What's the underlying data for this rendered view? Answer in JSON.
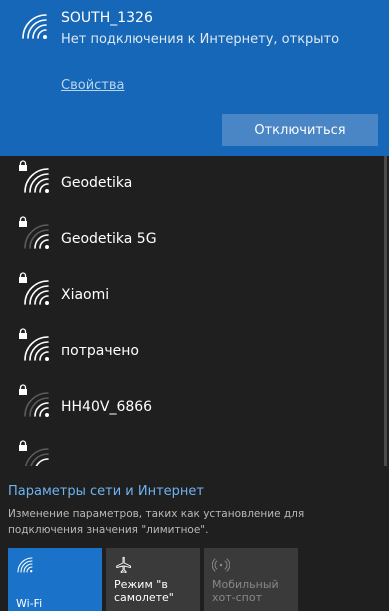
{
  "connected": {
    "name": "SOUTH_1326",
    "status": "Нет подключения к Интернету, открыто",
    "properties_link": "Свойства",
    "disconnect_label": "Отключиться"
  },
  "networks": [
    {
      "name": "Geodetika",
      "secured": true,
      "icon": "wifi-icon"
    },
    {
      "name": "Geodetika 5G",
      "secured": true,
      "icon": "wifi-icon"
    },
    {
      "name": "Xiaomi",
      "secured": true,
      "icon": "wifi-icon"
    },
    {
      "name": "потрачено",
      "secured": true,
      "icon": "wifi-icon"
    },
    {
      "name": "HH40V_6866",
      "secured": true,
      "icon": "wifi-icon"
    }
  ],
  "settings": {
    "link": "Параметры сети и Интернет",
    "description": "Изменение параметров, таких как установление для подключения значения \"лимитное\"."
  },
  "quick_actions": [
    {
      "label": "Wi-Fi",
      "icon": "wifi-icon",
      "active": true
    },
    {
      "label": "Режим \"в самолете\"",
      "icon": "airplane-icon",
      "active": false
    },
    {
      "label": "Мобильный хот-спот",
      "icon": "hotspot-icon",
      "active": false,
      "disabled": true
    }
  ],
  "colors": {
    "accent": "#1667b7",
    "tile_active": "#1a73c9",
    "panel_bg": "#1f1f1f",
    "link": "#6fb3f2"
  }
}
